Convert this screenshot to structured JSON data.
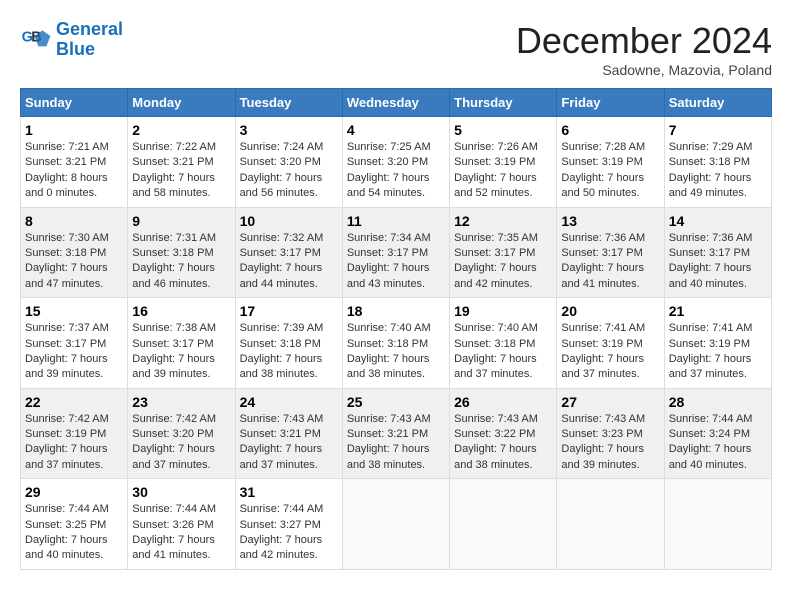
{
  "logo": {
    "line1": "General",
    "line2": "Blue"
  },
  "title": "December 2024",
  "subtitle": "Sadowne, Mazovia, Poland",
  "weekdays": [
    "Sunday",
    "Monday",
    "Tuesday",
    "Wednesday",
    "Thursday",
    "Friday",
    "Saturday"
  ],
  "weeks": [
    [
      {
        "day": "1",
        "sunrise": "Sunrise: 7:21 AM",
        "sunset": "Sunset: 3:21 PM",
        "daylight": "Daylight: 8 hours and 0 minutes."
      },
      {
        "day": "2",
        "sunrise": "Sunrise: 7:22 AM",
        "sunset": "Sunset: 3:21 PM",
        "daylight": "Daylight: 7 hours and 58 minutes."
      },
      {
        "day": "3",
        "sunrise": "Sunrise: 7:24 AM",
        "sunset": "Sunset: 3:20 PM",
        "daylight": "Daylight: 7 hours and 56 minutes."
      },
      {
        "day": "4",
        "sunrise": "Sunrise: 7:25 AM",
        "sunset": "Sunset: 3:20 PM",
        "daylight": "Daylight: 7 hours and 54 minutes."
      },
      {
        "day": "5",
        "sunrise": "Sunrise: 7:26 AM",
        "sunset": "Sunset: 3:19 PM",
        "daylight": "Daylight: 7 hours and 52 minutes."
      },
      {
        "day": "6",
        "sunrise": "Sunrise: 7:28 AM",
        "sunset": "Sunset: 3:19 PM",
        "daylight": "Daylight: 7 hours and 50 minutes."
      },
      {
        "day": "7",
        "sunrise": "Sunrise: 7:29 AM",
        "sunset": "Sunset: 3:18 PM",
        "daylight": "Daylight: 7 hours and 49 minutes."
      }
    ],
    [
      {
        "day": "8",
        "sunrise": "Sunrise: 7:30 AM",
        "sunset": "Sunset: 3:18 PM",
        "daylight": "Daylight: 7 hours and 47 minutes."
      },
      {
        "day": "9",
        "sunrise": "Sunrise: 7:31 AM",
        "sunset": "Sunset: 3:18 PM",
        "daylight": "Daylight: 7 hours and 46 minutes."
      },
      {
        "day": "10",
        "sunrise": "Sunrise: 7:32 AM",
        "sunset": "Sunset: 3:17 PM",
        "daylight": "Daylight: 7 hours and 44 minutes."
      },
      {
        "day": "11",
        "sunrise": "Sunrise: 7:34 AM",
        "sunset": "Sunset: 3:17 PM",
        "daylight": "Daylight: 7 hours and 43 minutes."
      },
      {
        "day": "12",
        "sunrise": "Sunrise: 7:35 AM",
        "sunset": "Sunset: 3:17 PM",
        "daylight": "Daylight: 7 hours and 42 minutes."
      },
      {
        "day": "13",
        "sunrise": "Sunrise: 7:36 AM",
        "sunset": "Sunset: 3:17 PM",
        "daylight": "Daylight: 7 hours and 41 minutes."
      },
      {
        "day": "14",
        "sunrise": "Sunrise: 7:36 AM",
        "sunset": "Sunset: 3:17 PM",
        "daylight": "Daylight: 7 hours and 40 minutes."
      }
    ],
    [
      {
        "day": "15",
        "sunrise": "Sunrise: 7:37 AM",
        "sunset": "Sunset: 3:17 PM",
        "daylight": "Daylight: 7 hours and 39 minutes."
      },
      {
        "day": "16",
        "sunrise": "Sunrise: 7:38 AM",
        "sunset": "Sunset: 3:17 PM",
        "daylight": "Daylight: 7 hours and 39 minutes."
      },
      {
        "day": "17",
        "sunrise": "Sunrise: 7:39 AM",
        "sunset": "Sunset: 3:18 PM",
        "daylight": "Daylight: 7 hours and 38 minutes."
      },
      {
        "day": "18",
        "sunrise": "Sunrise: 7:40 AM",
        "sunset": "Sunset: 3:18 PM",
        "daylight": "Daylight: 7 hours and 38 minutes."
      },
      {
        "day": "19",
        "sunrise": "Sunrise: 7:40 AM",
        "sunset": "Sunset: 3:18 PM",
        "daylight": "Daylight: 7 hours and 37 minutes."
      },
      {
        "day": "20",
        "sunrise": "Sunrise: 7:41 AM",
        "sunset": "Sunset: 3:19 PM",
        "daylight": "Daylight: 7 hours and 37 minutes."
      },
      {
        "day": "21",
        "sunrise": "Sunrise: 7:41 AM",
        "sunset": "Sunset: 3:19 PM",
        "daylight": "Daylight: 7 hours and 37 minutes."
      }
    ],
    [
      {
        "day": "22",
        "sunrise": "Sunrise: 7:42 AM",
        "sunset": "Sunset: 3:19 PM",
        "daylight": "Daylight: 7 hours and 37 minutes."
      },
      {
        "day": "23",
        "sunrise": "Sunrise: 7:42 AM",
        "sunset": "Sunset: 3:20 PM",
        "daylight": "Daylight: 7 hours and 37 minutes."
      },
      {
        "day": "24",
        "sunrise": "Sunrise: 7:43 AM",
        "sunset": "Sunset: 3:21 PM",
        "daylight": "Daylight: 7 hours and 37 minutes."
      },
      {
        "day": "25",
        "sunrise": "Sunrise: 7:43 AM",
        "sunset": "Sunset: 3:21 PM",
        "daylight": "Daylight: 7 hours and 38 minutes."
      },
      {
        "day": "26",
        "sunrise": "Sunrise: 7:43 AM",
        "sunset": "Sunset: 3:22 PM",
        "daylight": "Daylight: 7 hours and 38 minutes."
      },
      {
        "day": "27",
        "sunrise": "Sunrise: 7:43 AM",
        "sunset": "Sunset: 3:23 PM",
        "daylight": "Daylight: 7 hours and 39 minutes."
      },
      {
        "day": "28",
        "sunrise": "Sunrise: 7:44 AM",
        "sunset": "Sunset: 3:24 PM",
        "daylight": "Daylight: 7 hours and 40 minutes."
      }
    ],
    [
      {
        "day": "29",
        "sunrise": "Sunrise: 7:44 AM",
        "sunset": "Sunset: 3:25 PM",
        "daylight": "Daylight: 7 hours and 40 minutes."
      },
      {
        "day": "30",
        "sunrise": "Sunrise: 7:44 AM",
        "sunset": "Sunset: 3:26 PM",
        "daylight": "Daylight: 7 hours and 41 minutes."
      },
      {
        "day": "31",
        "sunrise": "Sunrise: 7:44 AM",
        "sunset": "Sunset: 3:27 PM",
        "daylight": "Daylight: 7 hours and 42 minutes."
      },
      null,
      null,
      null,
      null
    ]
  ]
}
